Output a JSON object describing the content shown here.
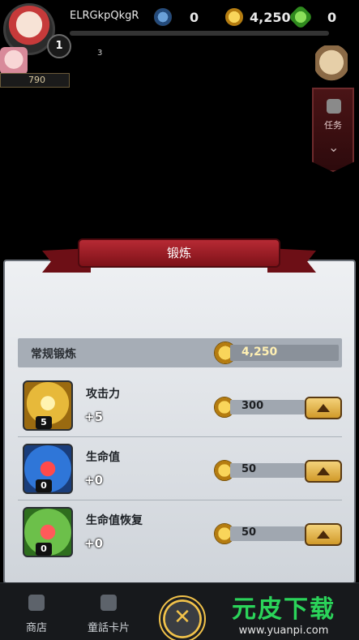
{
  "hud": {
    "username": "ELRGkpQkgR",
    "level": "1",
    "pet_level": "3",
    "resources": {
      "gear": "0",
      "gold": "4,250",
      "gem": "0"
    },
    "power_partial": "790",
    "quest_label": "任务"
  },
  "dialog": {
    "title": "锻炼",
    "section": {
      "title": "常规锻炼",
      "gold": "4,250"
    },
    "rows": [
      {
        "name": "攻击力",
        "level": "5",
        "bonus": "+5",
        "cost": "300",
        "icon": "sword-icon"
      },
      {
        "name": "生命值",
        "level": "0",
        "bonus": "+0",
        "cost": "50",
        "icon": "heart-icon"
      },
      {
        "name": "生命值恢复",
        "level": "0",
        "bonus": "+0",
        "cost": "50",
        "icon": "heart-regen-icon"
      }
    ]
  },
  "nav": {
    "shop": "商店",
    "cards": "童話卡片"
  },
  "watermark": {
    "big": "元皮下载",
    "url": "www.yuanpi.com"
  },
  "colors": {
    "accent_gold": "#f1c24a",
    "ribbon_red": "#b72a34",
    "panel_bg": "#eef0f3"
  }
}
